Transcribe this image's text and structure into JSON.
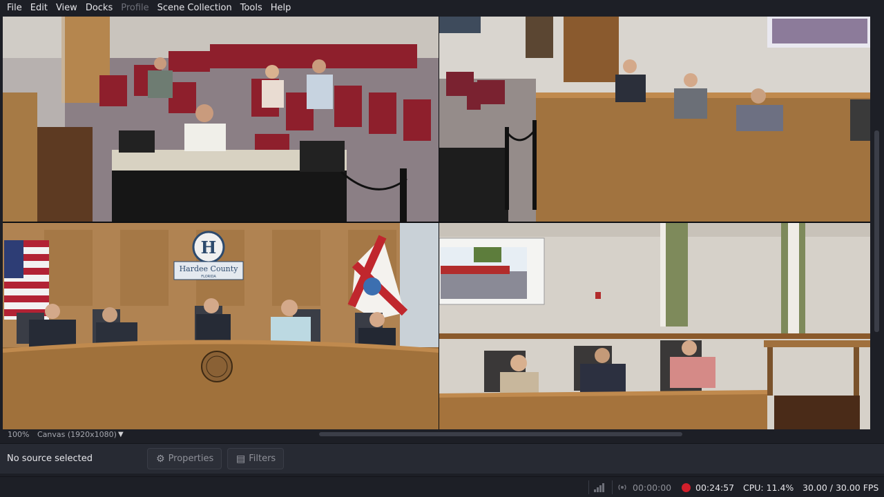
{
  "menu": [
    {
      "label": "File",
      "enabled": true
    },
    {
      "label": "Edit",
      "enabled": true
    },
    {
      "label": "View",
      "enabled": true
    },
    {
      "label": "Docks",
      "enabled": true
    },
    {
      "label": "Profile",
      "enabled": false
    },
    {
      "label": "Scene Collection",
      "enabled": true
    },
    {
      "label": "Tools",
      "enabled": true
    },
    {
      "label": "Help",
      "enabled": true
    }
  ],
  "preview": {
    "zoom": "100%",
    "canvas": "Canvas (1920x1080)",
    "dropdown_icon": "chevron-down-icon",
    "seal": {
      "header": "Hardee County",
      "subheader": "FLORIDA"
    }
  },
  "context": {
    "no_source": "No source selected",
    "properties_label": "Properties",
    "properties_icon": "gear-icon",
    "filters_label": "Filters",
    "filters_icon": "filter-icon"
  },
  "status": {
    "stream_time": "00:00:00",
    "rec_time": "00:24:57",
    "cpu": "CPU: 11.4%",
    "fps": "30.00 / 30.00 FPS",
    "rec_color": "#d21f2b"
  }
}
